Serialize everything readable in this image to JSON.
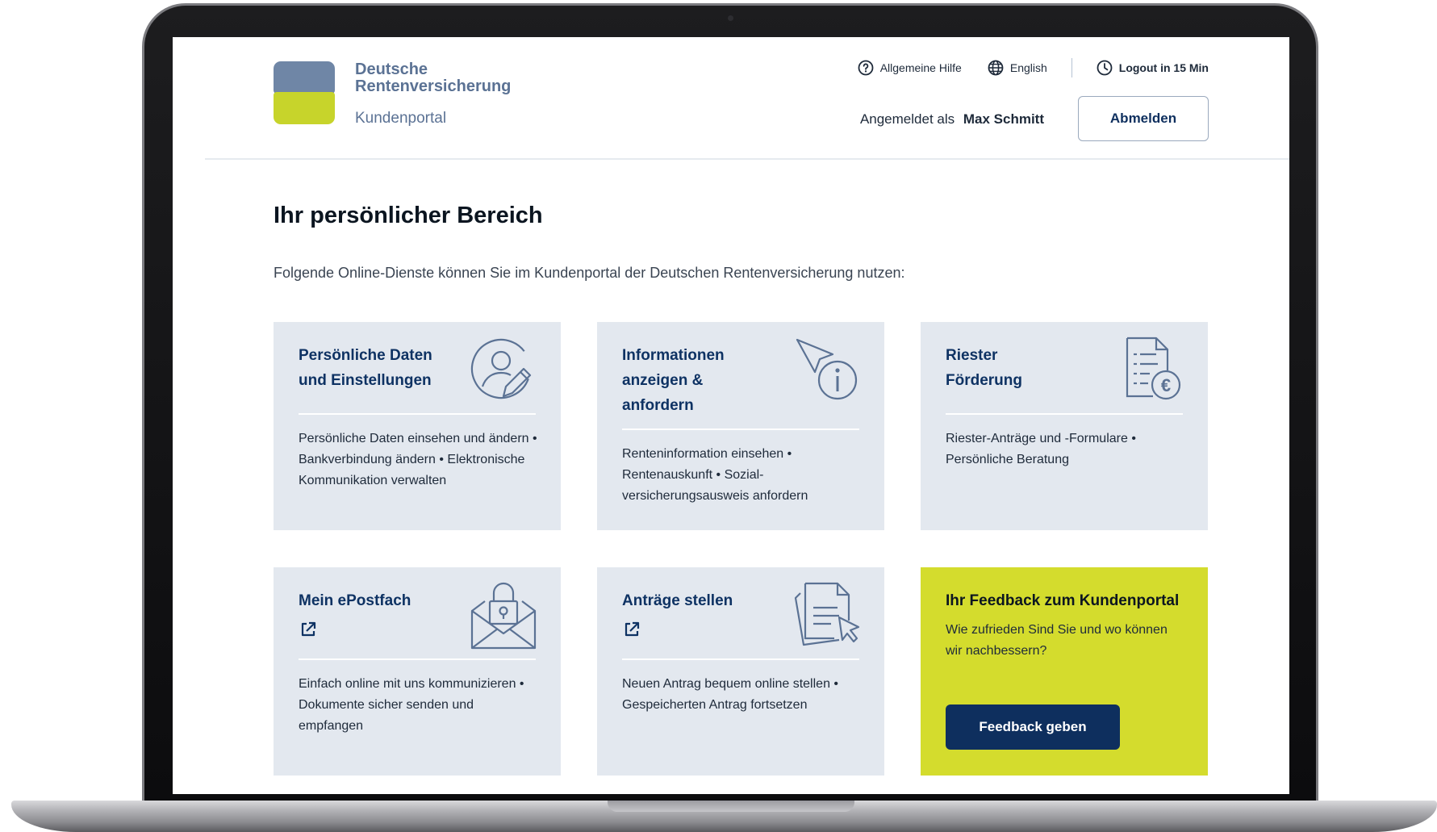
{
  "header": {
    "brand_line1": "Deutsche",
    "brand_line2": "Rentenversicherung",
    "portal_name": "Kundenportal",
    "help_label": "Allgemeine Hilfe",
    "language_label": "English",
    "logout_timer_label": "Logout in 15 Min",
    "logged_in_prefix": "Angemeldet als",
    "user_name": "Max Schmitt",
    "logout_button": "Abmelden"
  },
  "main": {
    "title": "Ihr persönlicher Bereich",
    "intro": "Folgende Online-Dienste können Sie im Kundenportal der Deutschen Rentenversicherung nutzen:"
  },
  "cards": [
    {
      "title": "Persönliche Daten\nund Einstellungen",
      "icon": "user-edit-icon",
      "description": "Persönliche Daten einsehen und ändern • Bankverbindung ändern • Elektronische Kommunikation verwalten"
    },
    {
      "title": "Informationen\nanzeigen &\nanfordern",
      "icon": "cursor-info-icon",
      "description": "Renteninformation einsehen • Rentenauskunft • Sozial-versicherungsausweis anfordern"
    },
    {
      "title": "Riester\nFörderung",
      "icon": "document-euro-icon",
      "description": "Riester-Anträge und -Formulare • Persönliche Beratung"
    },
    {
      "title": "Mein ePostfach",
      "icon": "locked-envelope-icon",
      "description": "Einfach online mit uns kommunizieren • Dokumente sicher senden und empfangen"
    },
    {
      "title": "Anträge stellen",
      "icon": "documents-cursor-icon",
      "description": "Neuen Antrag bequem online stellen • Gespeicherten Antrag fortsetzen"
    }
  ],
  "feedback": {
    "title": "Ihr Feedback zum Kundenportal",
    "description": "Wie zufrieden Sind Sie und wo können wir nachbessern?",
    "button": "Feedback geben"
  },
  "colors": {
    "navy": "#0e2f5e",
    "card_bg": "#e3e8ef",
    "accent_lime": "#d4dc2d",
    "logo_blue": "#6f86a6",
    "logo_lime": "#c7d42b"
  }
}
